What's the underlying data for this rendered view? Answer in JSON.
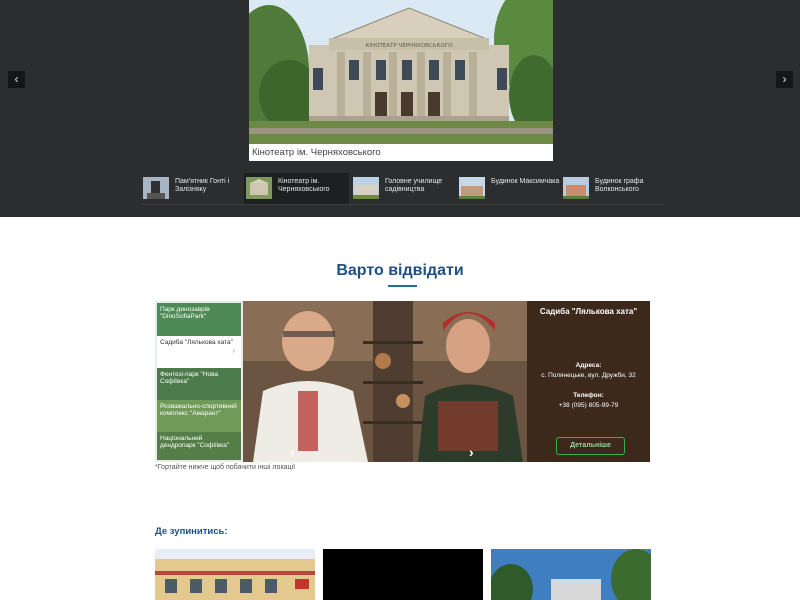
{
  "hero": {
    "prev_label": "‹",
    "next_label": "›",
    "caption": "Кінотеатр ім. Черняховського",
    "building_sign": "КІНОТЕАТР ЧЕРНЯХОВСЬКОГО"
  },
  "thumbs": [
    {
      "label": "Пам'ятник Гонті і Залізняку"
    },
    {
      "label": "Кінотеатр ім. Черняховського"
    },
    {
      "label": "Головне училище садівництва"
    },
    {
      "label": "Будинок Максимчака"
    },
    {
      "label": "Будинок графа Волконського"
    }
  ],
  "visit": {
    "section_title": "Варто відвідати",
    "list": [
      {
        "label": "Парк динозаврів \"DinoSofiaPark\""
      },
      {
        "label": "Садиба \"Лялькова хата\""
      },
      {
        "label": "Фентезі-парк \"Нова Софіївка\""
      },
      {
        "label": "Розважально-спортивний комплекс \"Амарант\""
      },
      {
        "label": "Національний дендропарк \"Софіївка\""
      }
    ],
    "info": {
      "title": "Садиба \"Лялькова хата\"",
      "address_label": "Адреса:",
      "address": "с. Полянецьке, вул. Дружби, 32",
      "phone_label": "Телефон:",
      "phone": "+38 (095) 805-99-79",
      "details_button": "Детальніше"
    },
    "prev_label": "‹",
    "next_label": "›",
    "swipe_hint": "*Гортайте нижче щоб побачити інші локації"
  },
  "stay": {
    "title": "Де зупинитись:"
  },
  "colors": {
    "hero_bg": "#2b2d2e",
    "accent_blue": "#1f4f86",
    "button_green": "#2fb34a"
  }
}
